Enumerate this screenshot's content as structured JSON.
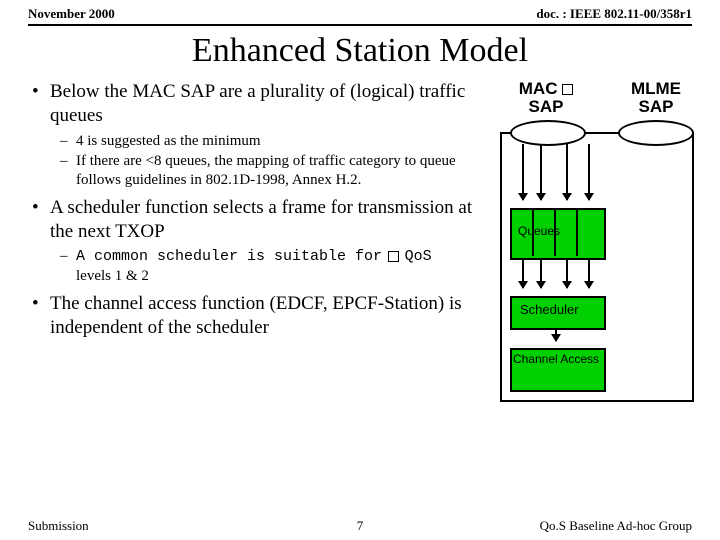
{
  "header": {
    "left": "November 2000",
    "right": "doc. : IEEE 802.11-00/358r1"
  },
  "title": "Enhanced Station Model",
  "bullets": {
    "b1": "Below the MAC SAP are a plurality of (logical) traffic queues",
    "b1a": "4 is suggested as the minimum",
    "b1b": "If there are <8 queues, the mapping of traffic category to queue follows guidelines in 802.1D-1998, Annex H.2.",
    "b2": "A scheduler function selects a frame for transmission at the next TXOP",
    "b2a_pre": "A common scheduler is suitable for",
    "b2a_post": "levels 1 & 2",
    "b2a_sq": "QoS",
    "b3": "The channel access function (EDCF, EPCF-Station) is independent of the scheduler"
  },
  "diagram": {
    "mac_line1": "MAC",
    "mac_line2": "SAP",
    "mlme_line1": "MLME",
    "mlme_line2": "SAP",
    "queues": "Queues",
    "scheduler": "Scheduler",
    "channel": "Channel Access"
  },
  "footer": {
    "left": "Submission",
    "page": "7",
    "right": "Qo.S Baseline Ad-hoc Group"
  }
}
